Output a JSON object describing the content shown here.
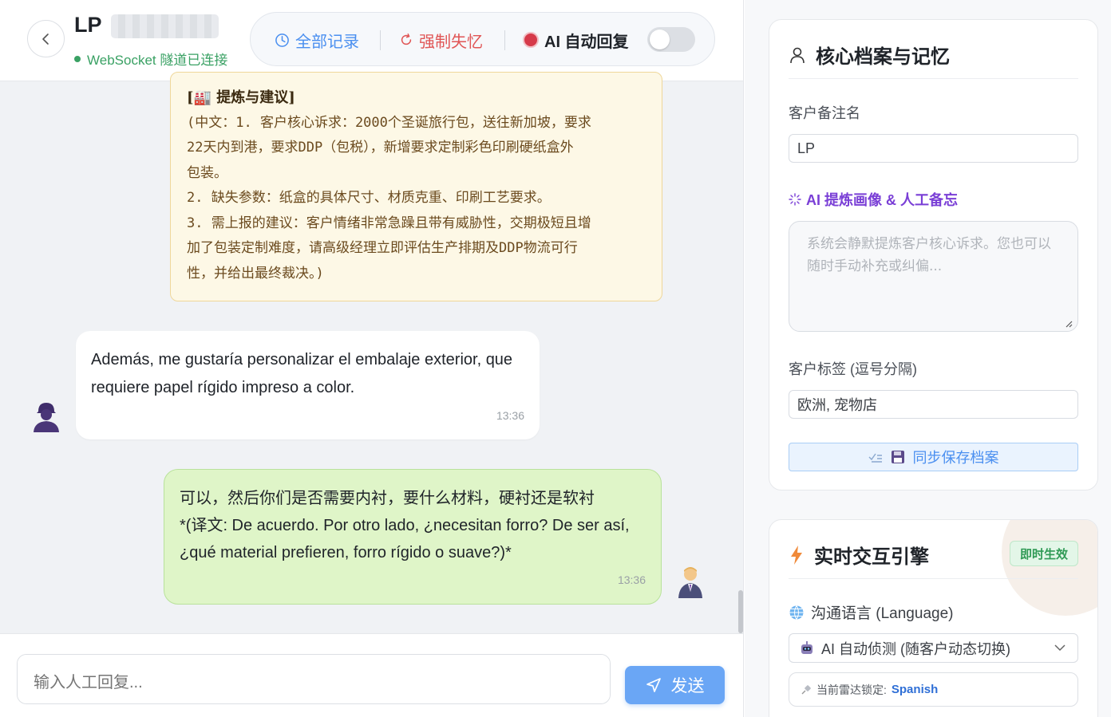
{
  "header": {
    "contact_name": "LP",
    "ws_status": "WebSocket 隧道已连接"
  },
  "toolbar": {
    "all_records": "全部记录",
    "force_forget": "强制失忆",
    "auto_reply": "AI 自动回复",
    "auto_reply_enabled": false
  },
  "messages": {
    "note": {
      "title": "[🏭 提炼与建议]",
      "lines": [
        "(中文：1. 客户核心诉求：2000个圣诞旅行包，送往新加坡，要求",
        "22天内到港，要求DDP（包税），新增要求定制彩色印刷硬纸盒外",
        "包装。",
        "2. 缺失参数：纸盒的具体尺寸、材质克重、印刷工艺要求。",
        "3. 需上报的建议：客户情绪非常急躁且带有威胁性，交期极短且增",
        "加了包装定制难度，请高级经理立即评估生产排期及DDP物流可行",
        "性，并给出最终裁决。)"
      ]
    },
    "incoming": {
      "text": "Además, me gustaría personalizar el embalaje exterior, que requiere papel rígido impreso a color.",
      "time": "13:36"
    },
    "outgoing": {
      "text_line1": "可以，然后你们是否需要内衬，要什么材料，硬衬还是软衬",
      "text_line2": "*(译文: De acuerdo. Por otro lado, ¿necesitan forro? De ser así, ¿qué material prefieren, forro rígido o suave?)*",
      "time": "13:36"
    }
  },
  "composer": {
    "placeholder": "输入人工回复...",
    "send_label": "发送"
  },
  "profile": {
    "title": "核心档案与记忆",
    "remark_label": "客户备注名",
    "remark_value": "LP",
    "ai_label": "AI 提炼画像 & 人工备忘",
    "memo_placeholder": "系统会静默提炼客户核心诉求。您也可以随时手动补充或纠偏...",
    "tags_label": "客户标签 (逗号分隔)",
    "tags_value": "欧洲, 宠物店",
    "save_label": "同步保存档案"
  },
  "engine": {
    "title": "实时交互引擎",
    "badge": "即时生效",
    "language_label": "沟通语言 (Language)",
    "language_selected": "AI 自动侦测 (随客户动态切换)",
    "lock_prefix": "当前雷达锁定:",
    "lock_language": "Spanish"
  },
  "colors": {
    "accent": "#4a8ff0",
    "success": "#3aa164",
    "danger": "#e05555",
    "ai_purple": "#7a3fd6"
  }
}
